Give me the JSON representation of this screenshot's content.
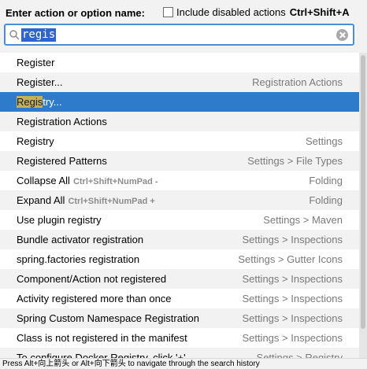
{
  "header": {
    "prompt": "Enter action or option name:",
    "include_disabled_label": "Include disabled actions",
    "include_disabled_shortcut": "Ctrl+Shift+A",
    "include_disabled_checked": false
  },
  "search": {
    "value": "regis"
  },
  "results": [
    {
      "name": "Register",
      "shortcut": "",
      "category": ""
    },
    {
      "name": "Register...",
      "shortcut": "",
      "category": "Registration Actions"
    },
    {
      "name_hl": "Regis",
      "name_rest": "try...",
      "shortcut": "",
      "category": "",
      "selected": true
    },
    {
      "name": "Registration Actions",
      "shortcut": "",
      "category": ""
    },
    {
      "name": "Registry",
      "shortcut": "",
      "category": "Settings"
    },
    {
      "name": "Registered Patterns",
      "shortcut": "",
      "category": "Settings > File Types"
    },
    {
      "name": "Collapse All",
      "shortcut": "Ctrl+Shift+NumPad -",
      "category": "Folding"
    },
    {
      "name": "Expand All",
      "shortcut": "Ctrl+Shift+NumPad +",
      "category": "Folding"
    },
    {
      "name": "Use plugin registry",
      "shortcut": "",
      "category": "Settings > Maven"
    },
    {
      "name": "Bundle activator registration",
      "shortcut": "",
      "category": "Settings > Inspections"
    },
    {
      "name": "spring.factories registration",
      "shortcut": "",
      "category": "Settings > Gutter Icons"
    },
    {
      "name": "Component/Action not registered",
      "shortcut": "",
      "category": "Settings > Inspections"
    },
    {
      "name": "Activity registered more than once",
      "shortcut": "",
      "category": "Settings > Inspections"
    },
    {
      "name": "Spring Custom Namespace Registration",
      "shortcut": "",
      "category": "Settings > Inspections"
    },
    {
      "name": "Class is not registered in the manifest",
      "shortcut": "",
      "category": "Settings > Inspections"
    },
    {
      "name": "To configure Docker Registry, click '+'",
      "shortcut": "",
      "category": "Settings > Registry"
    }
  ],
  "footer": {
    "hint": "Press Alt+向上箭头 or Alt+向下箭头 to navigate through the search history"
  }
}
